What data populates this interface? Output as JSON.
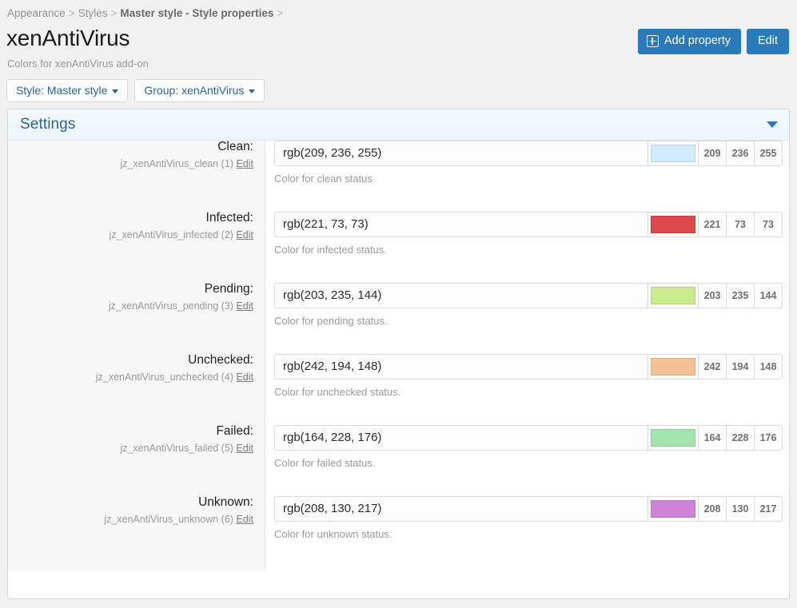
{
  "breadcrumb": {
    "items": [
      {
        "label": "Appearance",
        "strong": false
      },
      {
        "label": "Styles",
        "strong": false
      },
      {
        "label": "Master style - Style properties",
        "strong": true
      }
    ],
    "separator": ">"
  },
  "header": {
    "title": "xenAntiVirus",
    "subtitle": "Colors for xenAntiVirus add-on",
    "add_property_label": "Add property",
    "add_property_icon": "plus-square-icon",
    "edit_label": "Edit"
  },
  "filters": [
    {
      "label": "Style: Master style",
      "icon": "chevron-down-icon"
    },
    {
      "label": "Group: xenAntiVirus",
      "icon": "chevron-down-icon"
    }
  ],
  "panel": {
    "title": "Settings",
    "collapse_icon": "caret-down-icon"
  },
  "properties": [
    {
      "label": "Clean:",
      "key": "jz_xenAntiVirus_clean (1)",
      "edit_label": "Edit",
      "value": "rgb(209, 236, 255)",
      "color": "#d1ecff",
      "r": "209",
      "g": "236",
      "b": "255",
      "hint": "Color for clean status"
    },
    {
      "label": "Infected:",
      "key": "jz_xenAntiVirus_infected (2)",
      "edit_label": "Edit",
      "value": "rgb(221, 73, 73)",
      "color": "#dd4949",
      "r": "221",
      "g": "73",
      "b": "73",
      "hint": "Color for infected status."
    },
    {
      "label": "Pending:",
      "key": "jz_xenAntiVirus_pending (3)",
      "edit_label": "Edit",
      "value": "rgb(203, 235, 144)",
      "color": "#cbeb90",
      "r": "203",
      "g": "235",
      "b": "144",
      "hint": "Color for pending status."
    },
    {
      "label": "Unchecked:",
      "key": "jz_xenAntiVirus_unchecked (4)",
      "edit_label": "Edit",
      "value": "rgb(242, 194, 148)",
      "color": "#f2c294",
      "r": "242",
      "g": "194",
      "b": "148",
      "hint": "Color for unchecked status."
    },
    {
      "label": "Failed:",
      "key": "jz_xenAntiVirus_failed (5)",
      "edit_label": "Edit",
      "value": "rgb(164, 228, 176)",
      "color": "#a4e4b0",
      "r": "164",
      "g": "228",
      "b": "176",
      "hint": "Color for failed status."
    },
    {
      "label": "Unknown:",
      "key": "jz_xenAntiVirus_unknown (6)",
      "edit_label": "Edit",
      "value": "rgb(208, 130, 217)",
      "color": "#d082d9",
      "r": "208",
      "g": "130",
      "b": "217",
      "hint": "Color for unknown status."
    }
  ],
  "colors": {
    "accent": "#2a7ab9",
    "link": "#2a6496",
    "page_bg": "#f1f1f1",
    "panel_head_bg": "#eef6fc"
  }
}
